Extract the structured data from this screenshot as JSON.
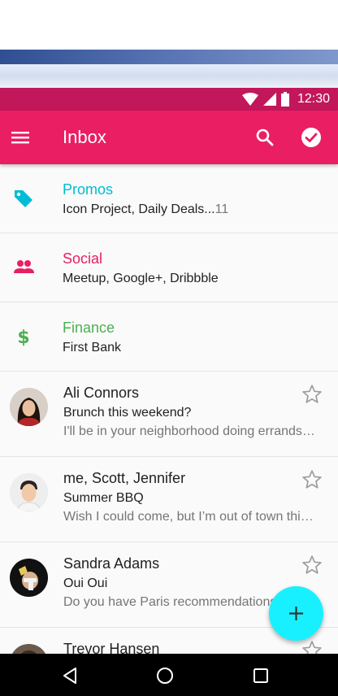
{
  "status_bar": {
    "time": "12:30"
  },
  "app_bar": {
    "title": "Inbox"
  },
  "categories": [
    {
      "title": "Promos",
      "subtitle": "Icon Project, Daily Deals...",
      "count": "11",
      "color": "#00bcd4",
      "icon": "tag-icon"
    },
    {
      "title": "Social",
      "subtitle": "Meetup, Google+, Dribbble",
      "count": "",
      "color": "#e91e63",
      "icon": "people-icon"
    },
    {
      "title": "Finance",
      "subtitle": "First Bank",
      "count": "",
      "color": "#4caf50",
      "icon": "dollar-icon"
    }
  ],
  "messages": [
    {
      "sender": "Ali Connors",
      "subject": "Brunch this weekend?",
      "preview": "I'll be in your neighborhood doing errands this weekend"
    },
    {
      "sender": "me, Scott, Jennifer",
      "subject": "Summer BBQ",
      "preview": "Wish I could come, but I’m out of town this weekend"
    },
    {
      "sender": "Sandra Adams",
      "subject": "Oui Oui",
      "preview": "Do you have Paris recommendations"
    },
    {
      "sender": "Trevor Hansen",
      "subject": "",
      "preview": ""
    }
  ],
  "colors": {
    "status_bar": "#c2185b",
    "app_bar": "#e91e63",
    "fab": "#19f0ff"
  }
}
